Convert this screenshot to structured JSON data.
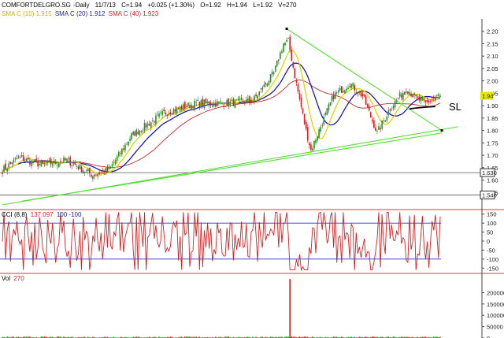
{
  "header": {
    "symbol": "COMFORTDELGRO.SG",
    "period": "Daily",
    "date": "11/7/13",
    "close": "C=1.94",
    "change": "+0.025 (+1.30%)",
    "open": "O=1.92",
    "high": "H=1.94",
    "low": "L=1.92",
    "volume": "V=270"
  },
  "legend": {
    "sma10": "SMA C (10) 1.915",
    "sma20": "SMA C (20) 1.912",
    "sma40": "SMA C (40) 1.923",
    "cci": "CCI (8,8)",
    "cci_value": "137.097",
    "cci_bands": "100 -100",
    "vol": "Vol",
    "vol_value": "270"
  },
  "annotation": {
    "sl": "SL"
  },
  "colors": {
    "up": "#1e9c1e",
    "down": "#d22222",
    "sma10": "#e6d200",
    "sma20": "#1a1aa8",
    "sma40": "#c82828",
    "trend": "#55dd33",
    "cci": "#d22222",
    "band": "#2a2ad0",
    "panel_sep": "#ff3030"
  },
  "chart_data": [
    {
      "type": "candlestick",
      "panel": "price",
      "ylim": [
        1.5,
        2.25
      ],
      "y_ticks": [
        "2.20",
        "2.15",
        "2.10",
        "2.05",
        "2.00",
        "1.95",
        "1.90",
        "1.85",
        "1.80",
        "1.75",
        "1.70",
        "1.65",
        "1.60",
        "1.55"
      ],
      "last_price": "1.94",
      "level_labels": [
        "1.630",
        "1.540"
      ],
      "levels": [
        1.63,
        1.54
      ],
      "key_closes": [
        {
          "bar": 0,
          "close": 1.64
        },
        {
          "bar": 10,
          "close": 1.69
        },
        {
          "bar": 25,
          "close": 1.66
        },
        {
          "bar": 40,
          "close": 1.68
        },
        {
          "bar": 56,
          "close": 1.62
        },
        {
          "bar": 66,
          "close": 1.64
        },
        {
          "bar": 80,
          "close": 1.78
        },
        {
          "bar": 100,
          "close": 1.87
        },
        {
          "bar": 120,
          "close": 1.91
        },
        {
          "bar": 140,
          "close": 1.91
        },
        {
          "bar": 155,
          "close": 1.92
        },
        {
          "bar": 168,
          "close": 2.03
        },
        {
          "bar": 174,
          "close": 2.15
        },
        {
          "bar": 177,
          "close": 2.16
        },
        {
          "bar": 181,
          "close": 2.02
        },
        {
          "bar": 188,
          "close": 1.8
        },
        {
          "bar": 191,
          "close": 1.72
        },
        {
          "bar": 196,
          "close": 1.8
        },
        {
          "bar": 205,
          "close": 1.94
        },
        {
          "bar": 215,
          "close": 1.99
        },
        {
          "bar": 223,
          "close": 1.94
        },
        {
          "bar": 232,
          "close": 1.79
        },
        {
          "bar": 240,
          "close": 1.89
        },
        {
          "bar": 250,
          "close": 1.97
        },
        {
          "bar": 256,
          "close": 1.93
        },
        {
          "bar": 262,
          "close": 1.91
        },
        {
          "bar": 270,
          "close": 1.94
        }
      ],
      "trendlines": [
        {
          "from": [
            0,
            1.5
          ],
          "to": [
            282,
            1.815
          ]
        },
        {
          "from": [
            12,
            1.515
          ],
          "to": [
            272,
            1.79
          ]
        },
        {
          "from": [
            176,
            2.21
          ],
          "to": [
            272,
            1.8
          ]
        }
      ],
      "sl_level": 1.89
    },
    {
      "type": "line",
      "panel": "cci",
      "name": "CCI (8,8)",
      "ylim": [
        -175,
        175
      ],
      "y_ticks": [
        "150",
        "100",
        "50",
        "0",
        "-50",
        "-100",
        "-150"
      ],
      "bands": [
        100,
        -100
      ]
    },
    {
      "type": "bar",
      "panel": "volume",
      "name": "Vol",
      "ylim": [
        0,
        250000
      ],
      "y_ticks": [
        "200000",
        "150000",
        "100000",
        "50000",
        "0"
      ],
      "spike": {
        "bar": 178,
        "value": 270000
      }
    }
  ]
}
